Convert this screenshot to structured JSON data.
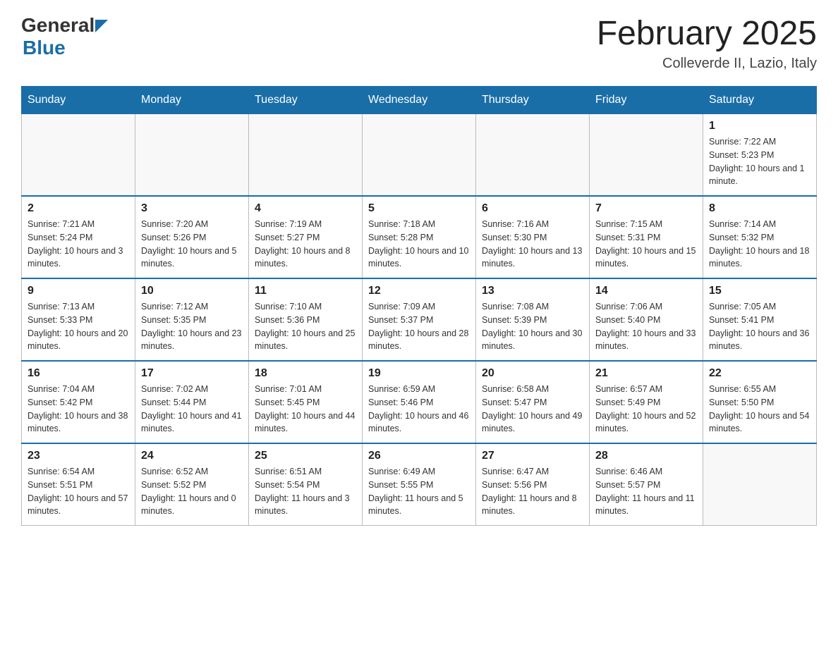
{
  "header": {
    "title": "February 2025",
    "subtitle": "Colleverde II, Lazio, Italy",
    "logo_general": "General",
    "logo_blue": "Blue"
  },
  "weekdays": [
    "Sunday",
    "Monday",
    "Tuesday",
    "Wednesday",
    "Thursday",
    "Friday",
    "Saturday"
  ],
  "weeks": [
    [
      {
        "day": "",
        "info": ""
      },
      {
        "day": "",
        "info": ""
      },
      {
        "day": "",
        "info": ""
      },
      {
        "day": "",
        "info": ""
      },
      {
        "day": "",
        "info": ""
      },
      {
        "day": "",
        "info": ""
      },
      {
        "day": "1",
        "info": "Sunrise: 7:22 AM\nSunset: 5:23 PM\nDaylight: 10 hours and 1 minute."
      }
    ],
    [
      {
        "day": "2",
        "info": "Sunrise: 7:21 AM\nSunset: 5:24 PM\nDaylight: 10 hours and 3 minutes."
      },
      {
        "day": "3",
        "info": "Sunrise: 7:20 AM\nSunset: 5:26 PM\nDaylight: 10 hours and 5 minutes."
      },
      {
        "day": "4",
        "info": "Sunrise: 7:19 AM\nSunset: 5:27 PM\nDaylight: 10 hours and 8 minutes."
      },
      {
        "day": "5",
        "info": "Sunrise: 7:18 AM\nSunset: 5:28 PM\nDaylight: 10 hours and 10 minutes."
      },
      {
        "day": "6",
        "info": "Sunrise: 7:16 AM\nSunset: 5:30 PM\nDaylight: 10 hours and 13 minutes."
      },
      {
        "day": "7",
        "info": "Sunrise: 7:15 AM\nSunset: 5:31 PM\nDaylight: 10 hours and 15 minutes."
      },
      {
        "day": "8",
        "info": "Sunrise: 7:14 AM\nSunset: 5:32 PM\nDaylight: 10 hours and 18 minutes."
      }
    ],
    [
      {
        "day": "9",
        "info": "Sunrise: 7:13 AM\nSunset: 5:33 PM\nDaylight: 10 hours and 20 minutes."
      },
      {
        "day": "10",
        "info": "Sunrise: 7:12 AM\nSunset: 5:35 PM\nDaylight: 10 hours and 23 minutes."
      },
      {
        "day": "11",
        "info": "Sunrise: 7:10 AM\nSunset: 5:36 PM\nDaylight: 10 hours and 25 minutes."
      },
      {
        "day": "12",
        "info": "Sunrise: 7:09 AM\nSunset: 5:37 PM\nDaylight: 10 hours and 28 minutes."
      },
      {
        "day": "13",
        "info": "Sunrise: 7:08 AM\nSunset: 5:39 PM\nDaylight: 10 hours and 30 minutes."
      },
      {
        "day": "14",
        "info": "Sunrise: 7:06 AM\nSunset: 5:40 PM\nDaylight: 10 hours and 33 minutes."
      },
      {
        "day": "15",
        "info": "Sunrise: 7:05 AM\nSunset: 5:41 PM\nDaylight: 10 hours and 36 minutes."
      }
    ],
    [
      {
        "day": "16",
        "info": "Sunrise: 7:04 AM\nSunset: 5:42 PM\nDaylight: 10 hours and 38 minutes."
      },
      {
        "day": "17",
        "info": "Sunrise: 7:02 AM\nSunset: 5:44 PM\nDaylight: 10 hours and 41 minutes."
      },
      {
        "day": "18",
        "info": "Sunrise: 7:01 AM\nSunset: 5:45 PM\nDaylight: 10 hours and 44 minutes."
      },
      {
        "day": "19",
        "info": "Sunrise: 6:59 AM\nSunset: 5:46 PM\nDaylight: 10 hours and 46 minutes."
      },
      {
        "day": "20",
        "info": "Sunrise: 6:58 AM\nSunset: 5:47 PM\nDaylight: 10 hours and 49 minutes."
      },
      {
        "day": "21",
        "info": "Sunrise: 6:57 AM\nSunset: 5:49 PM\nDaylight: 10 hours and 52 minutes."
      },
      {
        "day": "22",
        "info": "Sunrise: 6:55 AM\nSunset: 5:50 PM\nDaylight: 10 hours and 54 minutes."
      }
    ],
    [
      {
        "day": "23",
        "info": "Sunrise: 6:54 AM\nSunset: 5:51 PM\nDaylight: 10 hours and 57 minutes."
      },
      {
        "day": "24",
        "info": "Sunrise: 6:52 AM\nSunset: 5:52 PM\nDaylight: 11 hours and 0 minutes."
      },
      {
        "day": "25",
        "info": "Sunrise: 6:51 AM\nSunset: 5:54 PM\nDaylight: 11 hours and 3 minutes."
      },
      {
        "day": "26",
        "info": "Sunrise: 6:49 AM\nSunset: 5:55 PM\nDaylight: 11 hours and 5 minutes."
      },
      {
        "day": "27",
        "info": "Sunrise: 6:47 AM\nSunset: 5:56 PM\nDaylight: 11 hours and 8 minutes."
      },
      {
        "day": "28",
        "info": "Sunrise: 6:46 AM\nSunset: 5:57 PM\nDaylight: 11 hours and 11 minutes."
      },
      {
        "day": "",
        "info": ""
      }
    ]
  ]
}
